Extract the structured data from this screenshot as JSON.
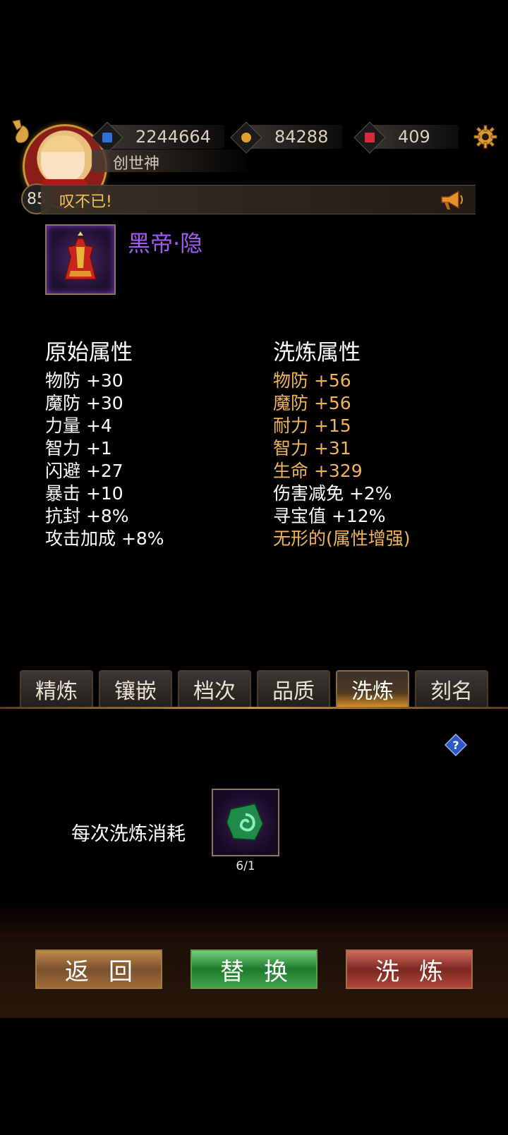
{
  "resources": {
    "diamond": "2244664",
    "gold": "84288",
    "ruby": "409"
  },
  "player": {
    "level": "85",
    "title": "创世神"
  },
  "broadcast": {
    "text": "叹不已!"
  },
  "item": {
    "name": "黑帝·隐",
    "quality_color": "#a45cf0"
  },
  "original_attributes": {
    "heading": "原始属性",
    "lines": [
      "物防 +30",
      "魔防 +30",
      "力量 +4",
      "智力 +1",
      "闪避 +27",
      "暴击 +10",
      "抗封 +8%",
      "攻击加成 +8%"
    ]
  },
  "refined_attributes": {
    "heading": "洗炼属性",
    "lines": [
      {
        "text": "物防 +56",
        "color": "gold"
      },
      {
        "text": "魔防 +56",
        "color": "gold"
      },
      {
        "text": "耐力 +15",
        "color": "gold"
      },
      {
        "text": "智力 +31",
        "color": "gold"
      },
      {
        "text": "生命 +329",
        "color": "gold"
      },
      {
        "text": "伤害减免 +2%",
        "color": "white"
      },
      {
        "text": "寻宝值 +12%",
        "color": "white"
      },
      {
        "text": "无形的(属性增强)",
        "color": "gold"
      }
    ]
  },
  "tabs": [
    {
      "label": "精炼",
      "active": false
    },
    {
      "label": "镶嵌",
      "active": false
    },
    {
      "label": "档次",
      "active": false
    },
    {
      "label": "品质",
      "active": false
    },
    {
      "label": "洗炼",
      "active": true
    },
    {
      "label": "刻名",
      "active": false
    }
  ],
  "cost": {
    "label": "每次洗炼消耗",
    "count": "6/1",
    "icon": "green-refine-stone-icon"
  },
  "buttons": {
    "back": "返回",
    "replace": "替换",
    "refine": "洗炼"
  },
  "colors": {
    "gold_text": "#f1b35a",
    "purple_name": "#a45cf0"
  }
}
